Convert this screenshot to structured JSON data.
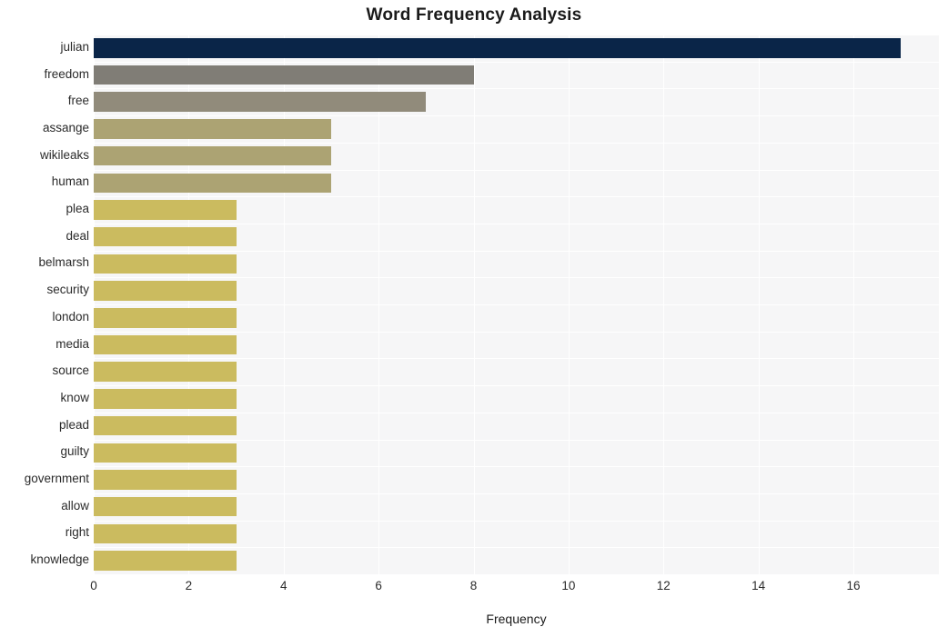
{
  "chart_data": {
    "type": "bar",
    "orientation": "horizontal",
    "title": "Word Frequency Analysis",
    "xlabel": "Frequency",
    "ylabel": "",
    "categories": [
      "julian",
      "freedom",
      "free",
      "assange",
      "wikileaks",
      "human",
      "plea",
      "deal",
      "belmarsh",
      "security",
      "london",
      "media",
      "source",
      "know",
      "plead",
      "guilty",
      "government",
      "allow",
      "right",
      "knowledge"
    ],
    "values": [
      17,
      8,
      7,
      5,
      5,
      5,
      3,
      3,
      3,
      3,
      3,
      3,
      3,
      3,
      3,
      3,
      3,
      3,
      3,
      3
    ],
    "bar_colors": [
      "#0a2548",
      "#807d76",
      "#918b7b",
      "#aca373",
      "#aca373",
      "#aca373",
      "#cbbb5f",
      "#cbbb5f",
      "#cbbb5f",
      "#cbbb5f",
      "#cbbb5f",
      "#cbbb5f",
      "#cbbb5f",
      "#cbbb5f",
      "#cbbb5f",
      "#cbbb5f",
      "#cbbb5f",
      "#cbbb5f",
      "#cbbb5f",
      "#cbbb5f"
    ],
    "xlim": [
      0,
      17.8
    ],
    "ylim_count": 20,
    "xticks": [
      0,
      2,
      4,
      6,
      8,
      10,
      12,
      14,
      16
    ],
    "xtick_labels": [
      "0",
      "2",
      "4",
      "6",
      "8",
      "10",
      "12",
      "14",
      "16"
    ],
    "grid": true,
    "grid_color": "#ffffff",
    "plot_background": "#f6f6f7",
    "figure_background": "#ffffff",
    "legend": null
  }
}
